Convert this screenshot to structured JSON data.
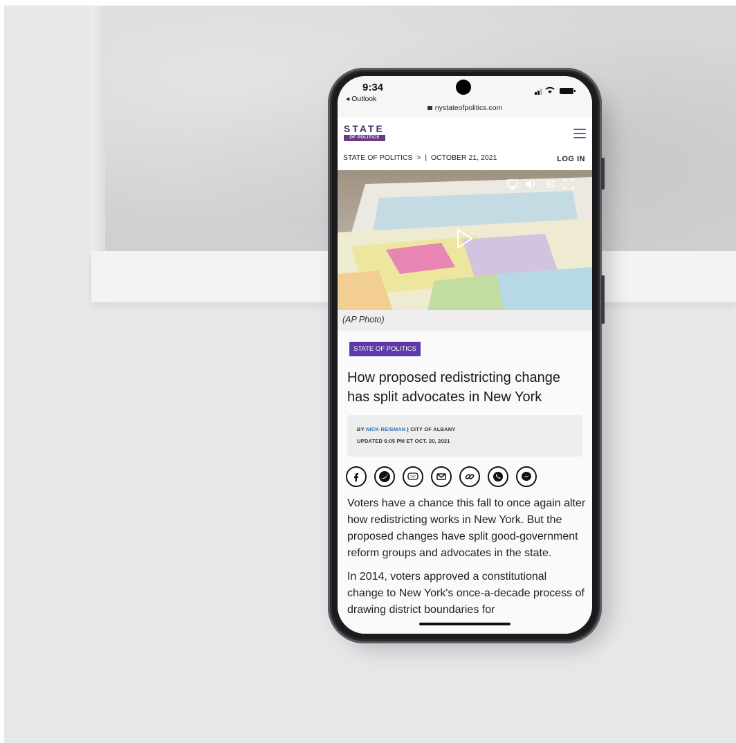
{
  "status_bar": {
    "time": "9:34",
    "back_label": "◂ Outlook",
    "url": "nystateofpolitics.com"
  },
  "header": {
    "logo_main": "STATE",
    "logo_sub": "OF POLITICS"
  },
  "breadcrumb": {
    "text": "STATE OF POLITICS  >  |  OCTOBER 21, 2021",
    "login_label": "LOG IN"
  },
  "video": {
    "caption": "(AP Photo)",
    "controls": [
      "airplay-icon",
      "volume-icon",
      "settings-icon",
      "fullscreen-icon",
      "play-icon"
    ]
  },
  "article": {
    "tag": "STATE OF POLITICS",
    "headline": "How proposed redistricting change has split advocates in New York",
    "byline_prefix": "BY ",
    "author": "NICK REISMAN",
    "location": " | CITY OF ALBANY",
    "updated": "UPDATED 6:05 PM ET OCT. 20, 2021",
    "share_icons": [
      "facebook-icon",
      "twitter-icon",
      "sms-icon",
      "email-icon",
      "link-icon",
      "whatsapp-icon",
      "messenger-icon"
    ],
    "paragraphs": [
      "Voters have a chance this fall to once again alter how redistricting works in New York. But the proposed changes have split good-government reform groups and advocates in the state.",
      "In 2014, voters approved a constitutional change to New York's once-a-decade process of drawing district boundaries for"
    ]
  },
  "colors": {
    "brand_purple": "#5d3aa8",
    "logo_purple": "#6b3b86",
    "author_link": "#2a6fb5"
  }
}
